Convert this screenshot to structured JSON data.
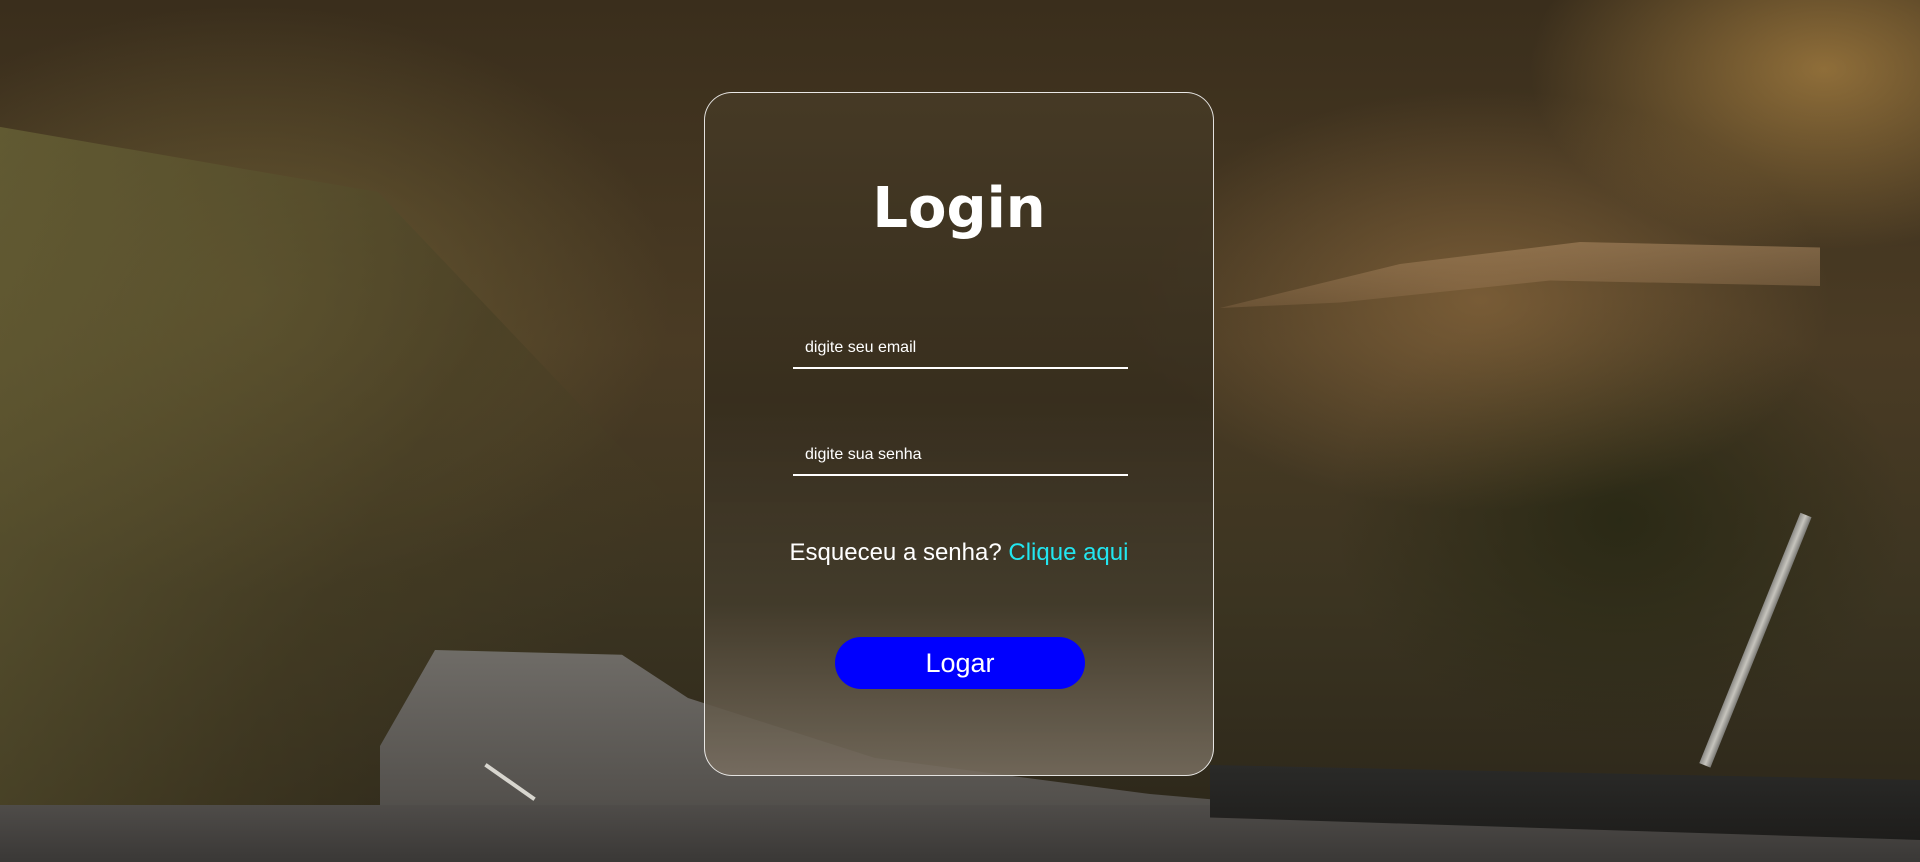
{
  "login": {
    "title": "Login",
    "email_placeholder": "digite seu email",
    "password_placeholder": "digite sua senha",
    "forgot_text": "Esqueceu a senha?",
    "forgot_link": "Clique aqui",
    "submit_label": "Logar"
  },
  "colors": {
    "button": "#0000fe",
    "link": "#22e6f0",
    "text": "#ffffff"
  }
}
